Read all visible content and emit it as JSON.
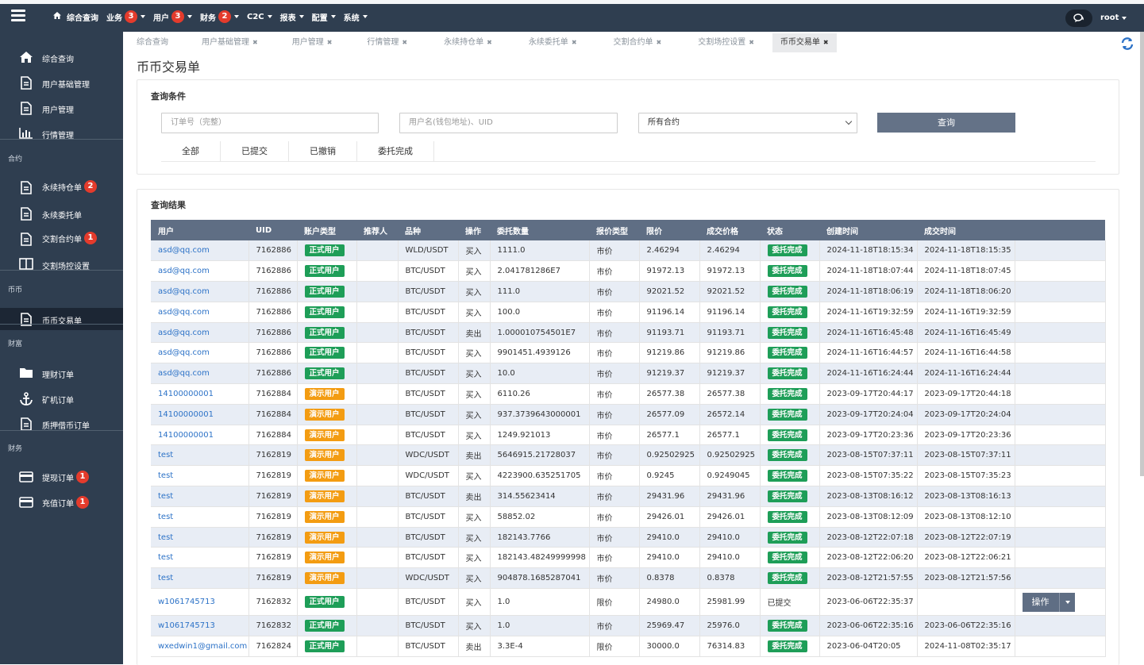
{
  "topbar": {
    "nav": [
      {
        "label": "综合查询",
        "badge": null,
        "dropdown": false,
        "icon": "home-icon"
      },
      {
        "label": "业务",
        "badge": "3",
        "dropdown": true
      },
      {
        "label": "用户",
        "badge": "3",
        "dropdown": true
      },
      {
        "label": "财务",
        "badge": "2",
        "dropdown": true
      },
      {
        "label": "C2C",
        "badge": null,
        "dropdown": true
      },
      {
        "label": "报表",
        "badge": null,
        "dropdown": true
      },
      {
        "label": "配置",
        "badge": null,
        "dropdown": true
      },
      {
        "label": "系统",
        "badge": null,
        "dropdown": true
      }
    ],
    "user": "root"
  },
  "sidebar": {
    "items": [
      {
        "label": "综合查询",
        "icon": "home-icon"
      },
      {
        "label": "用户基础管理",
        "icon": "document-icon"
      },
      {
        "label": "用户管理",
        "icon": "document-icon"
      },
      {
        "label": "行情管理",
        "icon": "bar-chart-icon"
      },
      {
        "label": "永续持仓单",
        "icon": "document-icon",
        "badge": "2"
      },
      {
        "label": "永续委托单",
        "icon": "document-icon"
      },
      {
        "label": "交割合约单",
        "icon": "document-icon",
        "badge": "1"
      },
      {
        "label": "交割场控设置",
        "icon": "columns-icon"
      },
      {
        "label": "币币交易单",
        "icon": "document-icon"
      },
      {
        "label": "理财订单",
        "icon": "folder-icon"
      },
      {
        "label": "矿机订单",
        "icon": "anchor-icon"
      },
      {
        "label": "质押借币订单",
        "icon": "document-icon"
      },
      {
        "label": "提现订单",
        "icon": "card-icon",
        "badge": "1"
      },
      {
        "label": "充值订单",
        "icon": "card-icon",
        "badge": "1"
      }
    ],
    "sections": [
      "合约",
      "币币",
      "财富",
      "财务"
    ]
  },
  "tabs": [
    {
      "label": "综合查询",
      "closable": false
    },
    {
      "label": "用户基础管理",
      "closable": true
    },
    {
      "label": "用户管理",
      "closable": true
    },
    {
      "label": "行情管理",
      "closable": true
    },
    {
      "label": "永续持仓单",
      "closable": true
    },
    {
      "label": "永续委托单",
      "closable": true
    },
    {
      "label": "交割合约单",
      "closable": true
    },
    {
      "label": "交割场控设置",
      "closable": true
    },
    {
      "label": "币币交易单",
      "closable": true,
      "active": true
    }
  ],
  "page_title": "币币交易单",
  "query": {
    "title": "查询条件",
    "order_placeholder": "订单号（完整）",
    "user_placeholder": "用户名(钱包地址)、UID",
    "contract_select": "所有合约",
    "button": "查询",
    "filters": [
      "全部",
      "已提交",
      "已撤销",
      "委托完成"
    ]
  },
  "results": {
    "title": "查询结果",
    "columns": [
      "用户",
      "UID",
      "账户类型",
      "推荐人",
      "品种",
      "操作",
      "委托数量",
      "报价类型",
      "限价",
      "成交价格",
      "状态",
      "创建时间",
      "成交时间",
      ""
    ],
    "op_button": "操作",
    "rows": [
      [
        "asd@qq.com",
        "7162886",
        "正式用户",
        "",
        "WLD/USDT",
        "买入",
        "1111.0",
        "市价",
        "2.46294",
        "2.46294",
        "委托完成",
        "2024-11-18T18:15:34",
        "2024-11-18T18:15:35",
        ""
      ],
      [
        "asd@qq.com",
        "7162886",
        "正式用户",
        "",
        "BTC/USDT",
        "买入",
        "2.041781286E7",
        "市价",
        "91972.13",
        "91972.13",
        "委托完成",
        "2024-11-18T18:07:44",
        "2024-11-18T18:07:45",
        ""
      ],
      [
        "asd@qq.com",
        "7162886",
        "正式用户",
        "",
        "BTC/USDT",
        "买入",
        "111.0",
        "市价",
        "92021.52",
        "92021.52",
        "委托完成",
        "2024-11-18T18:06:19",
        "2024-11-18T18:06:20",
        ""
      ],
      [
        "asd@qq.com",
        "7162886",
        "正式用户",
        "",
        "BTC/USDT",
        "买入",
        "100.0",
        "市价",
        "91196.14",
        "91196.14",
        "委托完成",
        "2024-11-16T19:32:59",
        "2024-11-16T19:32:59",
        ""
      ],
      [
        "asd@qq.com",
        "7162886",
        "正式用户",
        "",
        "BTC/USDT",
        "卖出",
        "1.000010754501E7",
        "市价",
        "91193.71",
        "91193.71",
        "委托完成",
        "2024-11-16T16:45:48",
        "2024-11-16T16:45:49",
        ""
      ],
      [
        "asd@qq.com",
        "7162886",
        "正式用户",
        "",
        "BTC/USDT",
        "买入",
        "9901451.4939126",
        "市价",
        "91219.86",
        "91219.86",
        "委托完成",
        "2024-11-16T16:44:57",
        "2024-11-16T16:44:58",
        ""
      ],
      [
        "asd@qq.com",
        "7162886",
        "正式用户",
        "",
        "BTC/USDT",
        "买入",
        "10.0",
        "市价",
        "91219.37",
        "91219.37",
        "委托完成",
        "2024-11-16T16:24:44",
        "2024-11-16T16:24:44",
        ""
      ],
      [
        "14100000001",
        "7162884",
        "演示用户",
        "",
        "BTC/USDT",
        "买入",
        "6110.26",
        "市价",
        "26577.38",
        "26577.38",
        "委托完成",
        "2023-09-17T20:44:17",
        "2023-09-17T20:44:18",
        ""
      ],
      [
        "14100000001",
        "7162884",
        "演示用户",
        "",
        "BTC/USDT",
        "买入",
        "937.3739643000001",
        "市价",
        "26577.09",
        "26572.14",
        "委托完成",
        "2023-09-17T20:24:04",
        "2023-09-17T20:24:04",
        ""
      ],
      [
        "14100000001",
        "7162884",
        "演示用户",
        "",
        "BTC/USDT",
        "买入",
        "1249.921013",
        "市价",
        "26577.1",
        "26577.1",
        "委托完成",
        "2023-09-17T20:23:36",
        "2023-09-17T20:23:36",
        ""
      ],
      [
        "test",
        "7162819",
        "演示用户",
        "",
        "WDC/USDT",
        "卖出",
        "5646915.21728037",
        "市价",
        "0.92502925",
        "0.92502925",
        "委托完成",
        "2023-08-15T07:37:11",
        "2023-08-15T07:37:11",
        ""
      ],
      [
        "test",
        "7162819",
        "演示用户",
        "",
        "WDC/USDT",
        "买入",
        "4223900.635251705",
        "市价",
        "0.9245",
        "0.9249045",
        "委托完成",
        "2023-08-15T07:35:22",
        "2023-08-15T07:35:23",
        ""
      ],
      [
        "test",
        "7162819",
        "演示用户",
        "",
        "BTC/USDT",
        "卖出",
        "314.55623414",
        "市价",
        "29431.96",
        "29431.96",
        "委托完成",
        "2023-08-13T08:16:12",
        "2023-08-13T08:16:13",
        ""
      ],
      [
        "test",
        "7162819",
        "演示用户",
        "",
        "BTC/USDT",
        "买入",
        "58852.02",
        "市价",
        "29426.01",
        "29426.01",
        "委托完成",
        "2023-08-13T08:12:09",
        "2023-08-13T08:12:10",
        ""
      ],
      [
        "test",
        "7162819",
        "演示用户",
        "",
        "BTC/USDT",
        "买入",
        "182143.7766",
        "市价",
        "29410.0",
        "29410.0",
        "委托完成",
        "2023-08-12T22:07:18",
        "2023-08-12T22:07:19",
        ""
      ],
      [
        "test",
        "7162819",
        "演示用户",
        "",
        "BTC/USDT",
        "买入",
        "182143.48249999998",
        "市价",
        "29410.0",
        "29410.0",
        "委托完成",
        "2023-08-12T22:06:20",
        "2023-08-12T22:06:21",
        ""
      ],
      [
        "test",
        "7162819",
        "演示用户",
        "",
        "WDC/USDT",
        "买入",
        "904878.1685287041",
        "市价",
        "0.8378",
        "0.8378",
        "委托完成",
        "2023-08-12T21:57:55",
        "2023-08-12T21:57:56",
        ""
      ],
      [
        "w1061745713",
        "7162832",
        "正式用户",
        "",
        "BTC/USDT",
        "买入",
        "1.0",
        "限价",
        "24980.0",
        "25981.99",
        "已提交",
        "2023-06-06T22:35:37",
        "",
        "操作"
      ],
      [
        "w1061745713",
        "7162832",
        "正式用户",
        "",
        "BTC/USDT",
        "买入",
        "1.0",
        "市价",
        "25969.47",
        "25976.0",
        "委托完成",
        "2023-06-06T22:35:16",
        "2023-06-06T22:35:16",
        ""
      ],
      [
        "wxedwin1@gmail.com",
        "7162824",
        "正式用户",
        "",
        "BTC/USDT",
        "卖出",
        "3.3E-4",
        "限价",
        "30000.0",
        "76314.83",
        "委托完成",
        "2023-06-04T20:05",
        "2024-11-08T02:35:17",
        ""
      ]
    ]
  },
  "colors": {
    "nav_bg": "#2f3e50",
    "header_bg": "#5f6e84",
    "green": "#1e9e58",
    "orange": "#f39c12",
    "badge": "#e43b2c",
    "link": "#2c72c7"
  }
}
